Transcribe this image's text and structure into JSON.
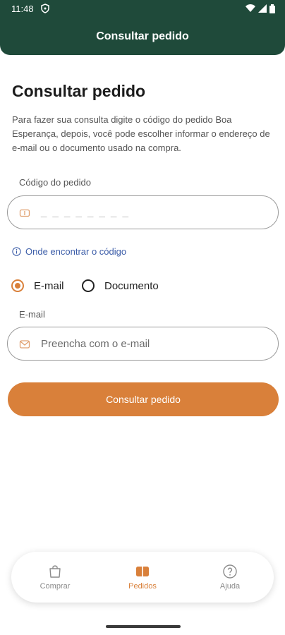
{
  "status": {
    "time": "11:48"
  },
  "header": {
    "title": "Consultar pedido"
  },
  "main": {
    "title": "Consultar pedido",
    "description": "Para fazer sua consulta digite o código do pedido Boa Esperança, depois, você pode escolher informar o endereço de e-mail ou o documento usado na compra.",
    "order_code": {
      "label": "Código do pedido",
      "value": "_ _ _ _ _ _ _ _"
    },
    "help_link": "Onde encontrar o código",
    "options": [
      {
        "label": "E-mail",
        "selected": true
      },
      {
        "label": "Documento",
        "selected": false
      }
    ],
    "email": {
      "label": "E-mail",
      "placeholder": "Preencha com o e-mail"
    },
    "submit_label": "Consultar pedido"
  },
  "nav": {
    "items": [
      {
        "label": "Comprar",
        "icon": "bag-icon",
        "active": false
      },
      {
        "label": "Pedidos",
        "icon": "orders-icon",
        "active": true
      },
      {
        "label": "Ajuda",
        "icon": "help-icon",
        "active": false
      }
    ]
  },
  "colors": {
    "header_bg": "#1f4a3a",
    "accent": "#d9803a",
    "link": "#3b5ca8"
  }
}
